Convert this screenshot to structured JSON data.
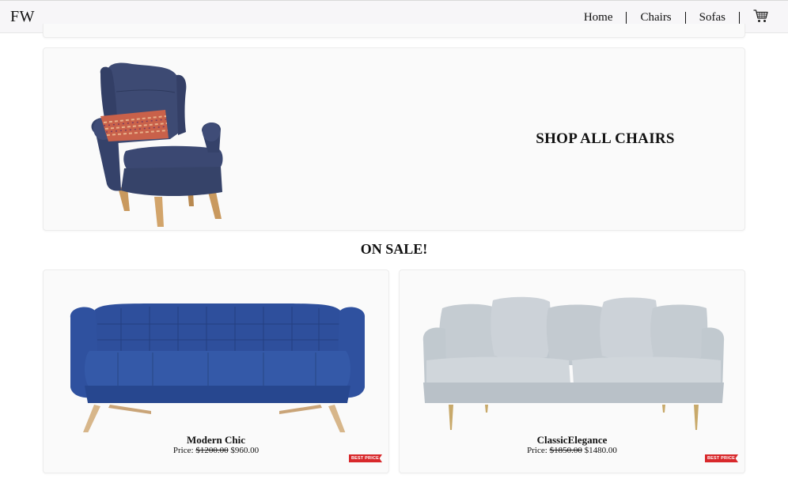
{
  "nav": {
    "brand": "FW",
    "links": [
      {
        "label": "Home"
      },
      {
        "label": "Chairs"
      },
      {
        "label": "Sofas"
      }
    ],
    "cart_icon": "shopping-cart-icon"
  },
  "hero": {
    "title": "SHOP ALL CHAIRS",
    "image_icon": "armchair-image"
  },
  "sale": {
    "title": "ON SALE!",
    "products": [
      {
        "name": "Modern Chic",
        "price_label": "Price:",
        "old_price": "$1200.00",
        "new_price": "$960.00",
        "badge": "BEST PRICE",
        "color": "#2d4f9a"
      },
      {
        "name": "ClassicElegance",
        "price_label": "Price:",
        "old_price": "$1850.00",
        "new_price": "$1480.00",
        "badge": "BEST PRICE",
        "color": "#c4cbd1"
      }
    ]
  },
  "colors": {
    "accent_badge": "#d8282b",
    "card_background": "#fafafa",
    "nav_background": "#f7f6f8"
  }
}
